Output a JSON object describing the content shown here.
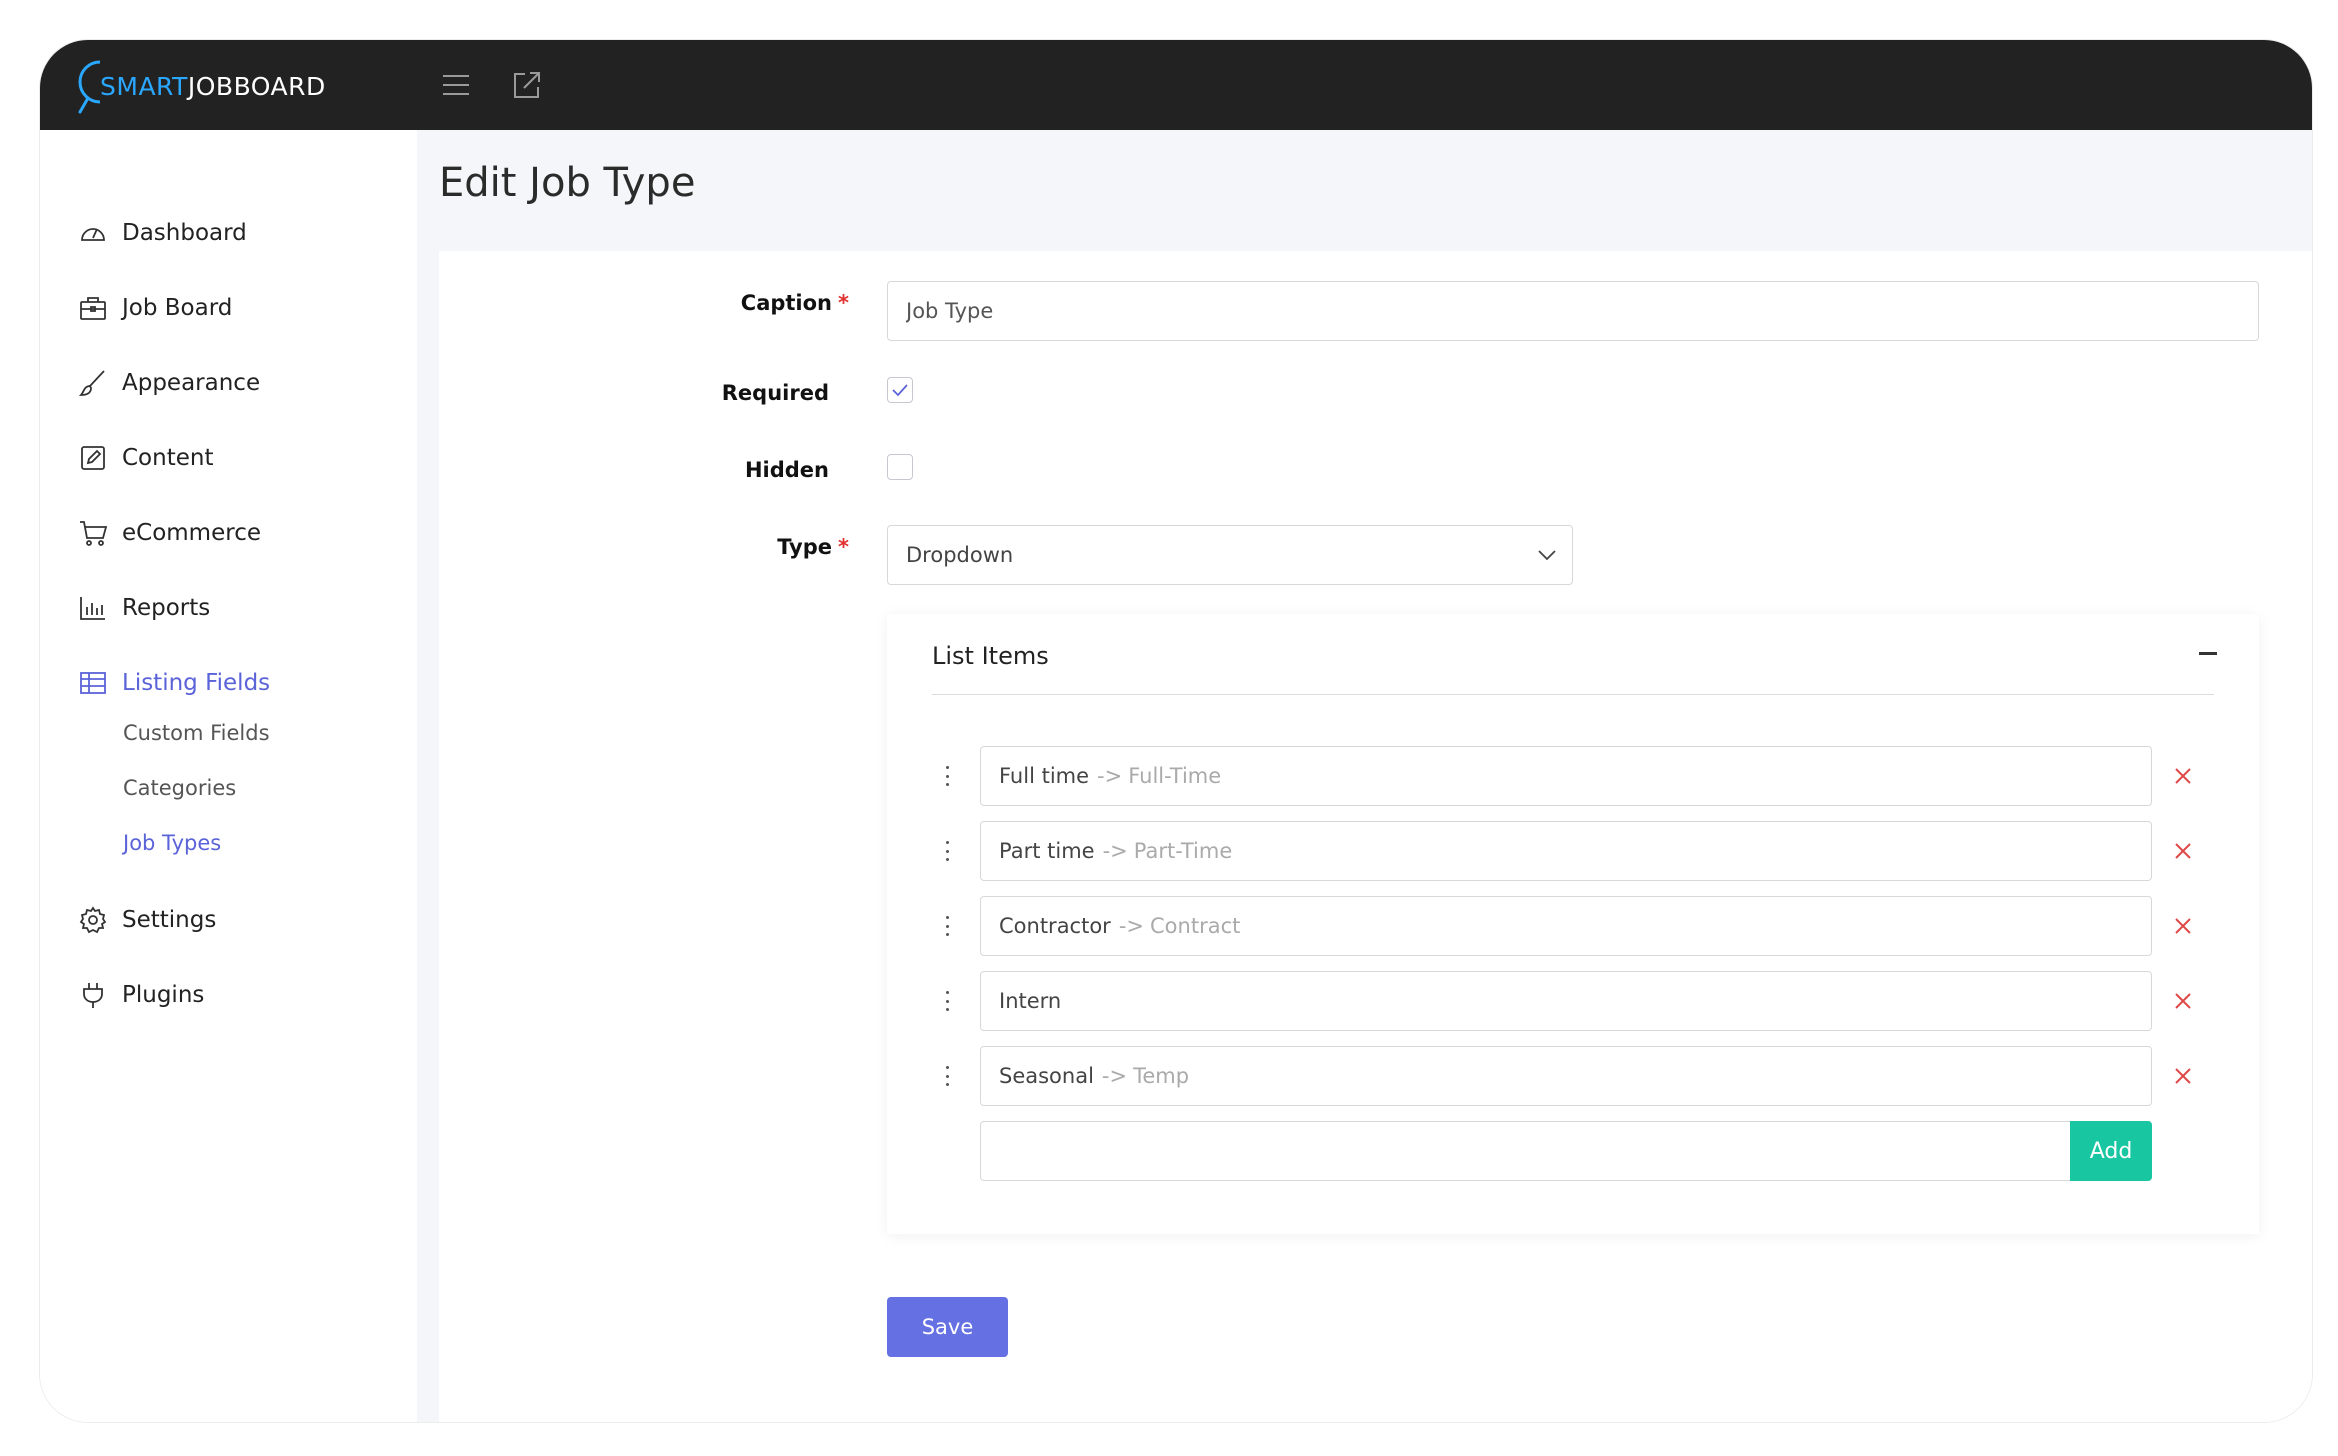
{
  "brand": {
    "smart": "SMART",
    "rest": "JOBBOARD",
    "accent": "#2aa7ff"
  },
  "topbar": {
    "menu_icon": "hamburger-icon",
    "external_icon": "external-link-icon"
  },
  "sidebar": {
    "items": [
      {
        "label": "Dashboard",
        "icon": "speedometer-icon"
      },
      {
        "label": "Job Board",
        "icon": "briefcase-icon"
      },
      {
        "label": "Appearance",
        "icon": "brush-icon"
      },
      {
        "label": "Content",
        "icon": "edit-square-icon"
      },
      {
        "label": "eCommerce",
        "icon": "cart-icon"
      },
      {
        "label": "Reports",
        "icon": "bar-chart-icon"
      },
      {
        "label": "Listing Fields",
        "icon": "table-icon",
        "active": true
      },
      {
        "label": "Settings",
        "icon": "gear-icon"
      },
      {
        "label": "Plugins",
        "icon": "plug-icon"
      }
    ],
    "subitems": [
      {
        "label": "Custom Fields"
      },
      {
        "label": "Categories"
      },
      {
        "label": "Job Types",
        "active": true
      }
    ],
    "active_color": "#5b63d8"
  },
  "page": {
    "title": "Edit Job Type"
  },
  "form": {
    "caption_label": "Caption",
    "caption_value": "Job Type",
    "required_label": "Required",
    "required_checked": true,
    "hidden_label": "Hidden",
    "hidden_checked": false,
    "type_label": "Type",
    "type_value": "Dropdown",
    "required_marker": "*"
  },
  "list_items": {
    "title": "List Items",
    "arrow": "->",
    "items": [
      {
        "value": "Full time",
        "alias": "Full-Time"
      },
      {
        "value": "Part time",
        "alias": "Part-Time"
      },
      {
        "value": "Contractor",
        "alias": "Contract"
      },
      {
        "value": "Intern",
        "alias": ""
      },
      {
        "value": "Seasonal",
        "alias": "Temp"
      }
    ],
    "new_item_value": "",
    "add_label": "Add",
    "add_color": "#19c6a2"
  },
  "save_label": "Save",
  "save_color": "#6571e2"
}
